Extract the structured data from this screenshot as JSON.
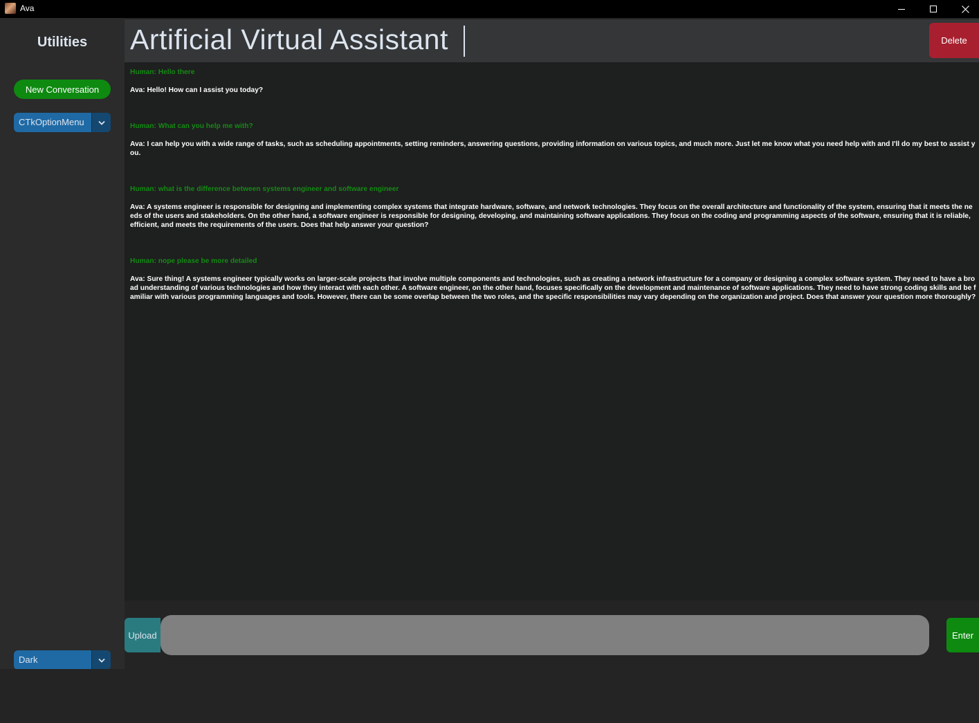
{
  "window": {
    "title": "Ava"
  },
  "sidebar": {
    "title": "Utilities",
    "new_conversation_label": "New Conversation",
    "option_menu_value": "CTkOptionMenu",
    "appearance_mode_value": "Dark"
  },
  "header": {
    "title": "Artificial Virtual Assistant",
    "delete_label": "Delete"
  },
  "messages": [
    {
      "role": "human",
      "text": "Human: Hello there"
    },
    {
      "role": "ava",
      "text": "Ava: Hello! How can I assist you today?"
    },
    {
      "role": "human",
      "text": "Human: What can you help me with?"
    },
    {
      "role": "ava",
      "text": "Ava: I can help you with a wide range of tasks, such as scheduling appointments, setting reminders, answering questions, providing information on various topics, and much more. Just let me know what you need help with and I'll do my best to assist you."
    },
    {
      "role": "human",
      "text": "Human: what is the difference between systems engineer and software engineer"
    },
    {
      "role": "ava",
      "text": "Ava: A systems engineer is responsible for designing and implementing complex systems that integrate hardware, software, and network technologies. They focus on the overall architecture and functionality of the system, ensuring that it meets the needs of the users and stakeholders. On the other hand, a software engineer is responsible for designing, developing, and maintaining software applications. They focus on the coding and programming aspects of the software, ensuring that it is reliable, efficient, and meets the requirements of the users. Does that help answer your question?"
    },
    {
      "role": "human",
      "text": "Human: nope please be more detailed"
    },
    {
      "role": "ava",
      "text": "Ava: Sure thing! A systems engineer typically works on larger-scale projects that involve multiple components and technologies, such as creating a network infrastructure for a company or designing a complex software system. They need to have a broad understanding of various technologies and how they interact with each other. A software engineer, on the other hand, focuses specifically on the development and maintenance of software applications. They need to have strong coding skills and be familiar with various programming languages and tools. However, there can be some overlap between the two roles, and the specific responsibilities may vary depending on the organization and project. Does that answer your question more thoroughly?"
    }
  ],
  "input": {
    "upload_label": "Upload",
    "message_value": "",
    "enter_label": "Enter"
  },
  "colors": {
    "human_text": "#148a14",
    "ava_text": "#ffffff",
    "accent_green": "#0e8a10",
    "delete_red": "#a8202f",
    "menu_blue": "#1f6aa5",
    "upload_teal": "#2a7b80"
  }
}
